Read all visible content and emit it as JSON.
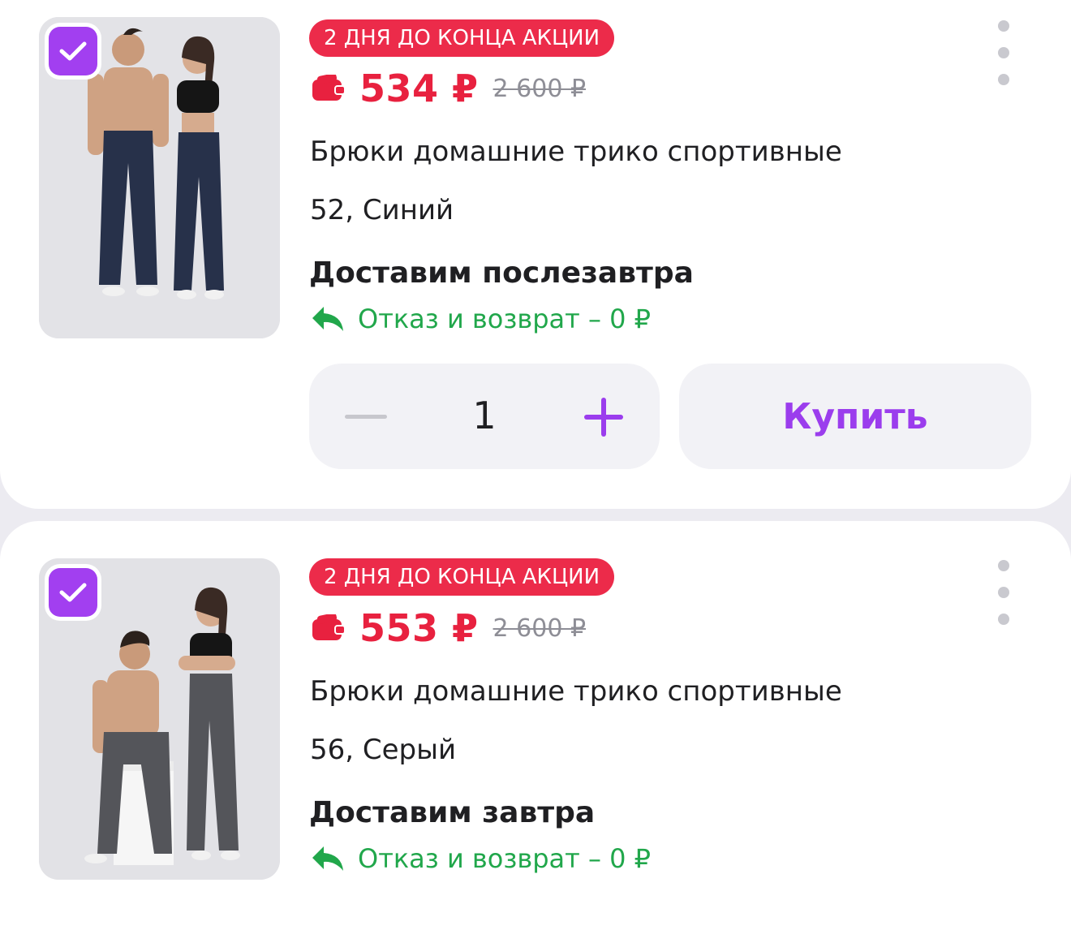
{
  "products": [
    {
      "badge": "2 ДНЯ ДО КОНЦА АКЦИИ",
      "price": "534 ₽",
      "old_price": "2 600 ₽",
      "title": "Брюки домашние трико спортивные",
      "variant": "52, Синий",
      "delivery": "Доставим послезавтра",
      "return_text": "Отказ и возврат – 0 ₽",
      "quantity": "1",
      "buy_label": "Купить",
      "selected": true,
      "pants_color": "#27314a"
    },
    {
      "badge": "2 ДНЯ ДО КОНЦА АКЦИИ",
      "price": "553 ₽",
      "old_price": "2 600 ₽",
      "title": "Брюки домашние трико спортивные",
      "variant": "56, Серый",
      "delivery": "Доставим завтра",
      "return_text": "Отказ и возврат – 0 ₽",
      "selected": true,
      "pants_color": "#54555a"
    }
  ],
  "colors": {
    "accent": "#a23ff0",
    "sale_red": "#ec2b4a",
    "price_red": "#e8213f",
    "return_green": "#21a74b"
  }
}
